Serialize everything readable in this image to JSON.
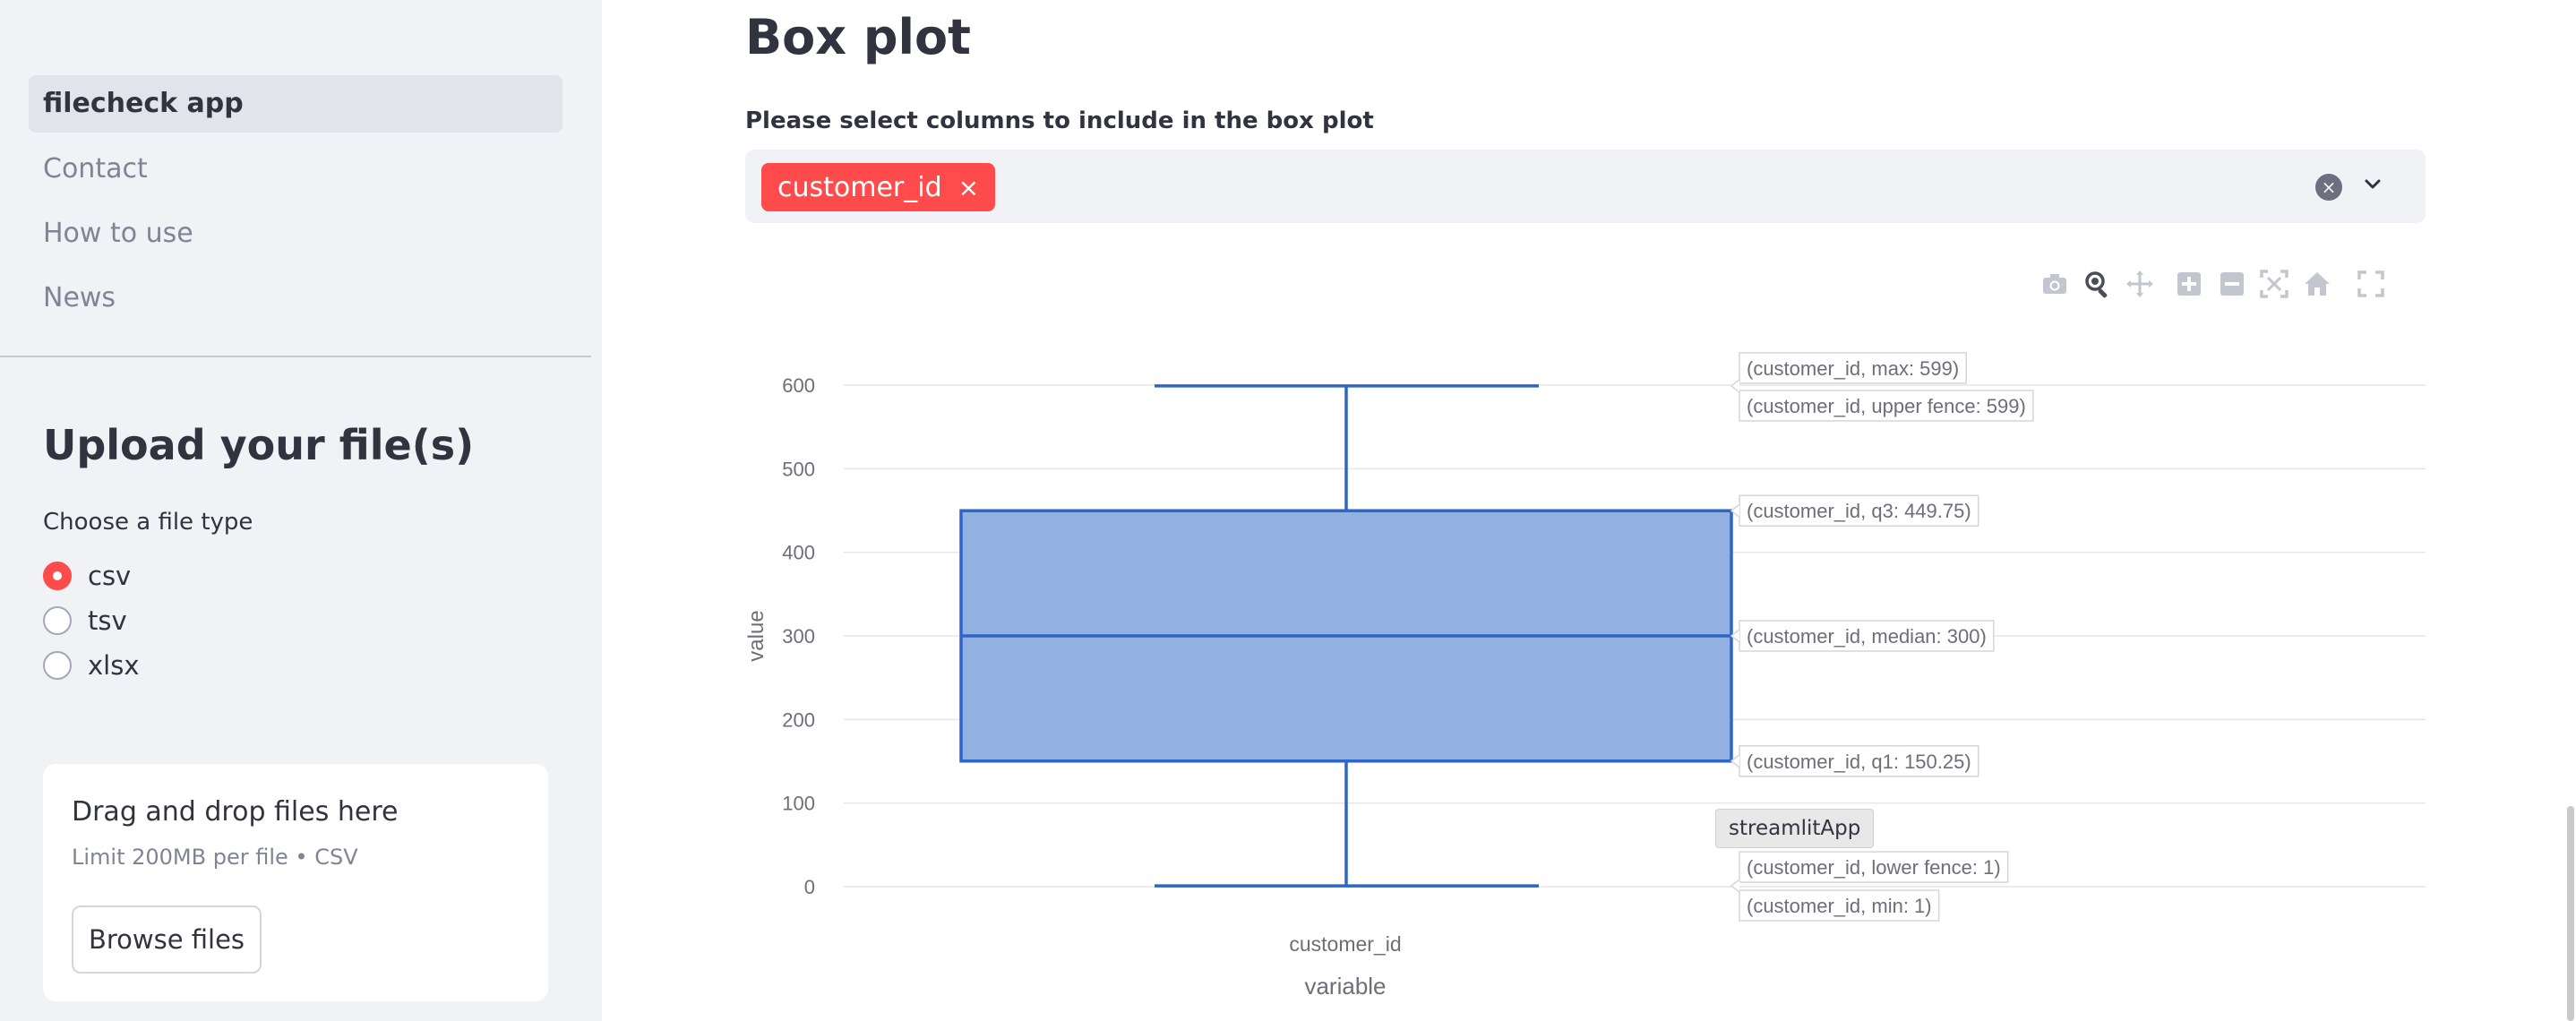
{
  "sidebar": {
    "nav": [
      {
        "label": "filecheck app",
        "active": true
      },
      {
        "label": "Contact",
        "active": false
      },
      {
        "label": "How to use",
        "active": false
      },
      {
        "label": "News",
        "active": false
      }
    ],
    "upload_heading": "Upload your file(s)",
    "filetype_label": "Choose a file type",
    "filetype_options": [
      {
        "label": "csv",
        "checked": true
      },
      {
        "label": "tsv",
        "checked": false
      },
      {
        "label": "xlsx",
        "checked": false
      }
    ],
    "dropzone": {
      "title": "Drag and drop files here",
      "limit": "Limit 200MB per file • CSV",
      "browse_label": "Browse files"
    }
  },
  "main": {
    "title": "Box plot",
    "select_label": "Please select columns to include in the box plot",
    "selected_tags": [
      "customer_id"
    ],
    "tag_remove_glyph": "×",
    "clear_glyph": "×",
    "modebar_icons": [
      "camera-icon",
      "zoom-icon",
      "pan-icon",
      "zoom-in-icon",
      "zoom-out-icon",
      "autoscale-icon",
      "home-icon",
      "fullscreen-icon"
    ],
    "hover_tooltip": "streamlitApp"
  },
  "colors": {
    "accent": "#ff4b4b",
    "box_fill": "#92b1e1",
    "box_line": "#2e66c7",
    "sidebar_bg": "#f0f2f6"
  },
  "chart_data": {
    "type": "box",
    "categories": [
      "customer_id"
    ],
    "xlabel": "variable",
    "ylabel": "value",
    "ylim": [
      -10,
      640
    ],
    "yticks": [
      0,
      100,
      200,
      300,
      400,
      500,
      600
    ],
    "grid": true,
    "series": [
      {
        "category": "customer_id",
        "min": 1,
        "lower_fence": 1,
        "q1": 150.25,
        "median": 300,
        "q3": 449.75,
        "upper_fence": 599,
        "max": 599
      }
    ],
    "annotations": [
      "(customer_id, max: 599)",
      "(customer_id, upper fence: 599)",
      "(customer_id, q3: 449.75)",
      "(customer_id, median: 300)",
      "(customer_id, q1: 150.25)",
      "(customer_id, lower fence: 1)",
      "(customer_id, min: 1)"
    ]
  }
}
